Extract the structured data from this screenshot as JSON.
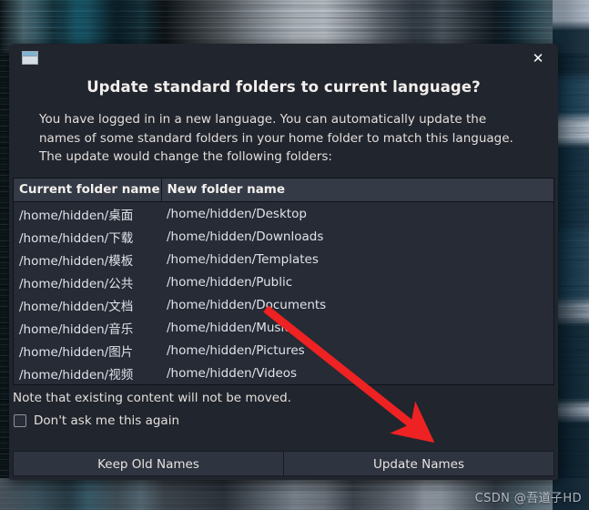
{
  "dialog": {
    "window_icon": "window-icon",
    "close_icon": "✕",
    "title": "Update standard folders to current language?",
    "body": "You have logged in in a new language. You can automatically update the names of some standard folders in your home folder to match this language. The update would change the following folders:",
    "note": "Note that existing content will not be moved.",
    "checkbox_label": "Don't ask me this again",
    "checkbox_checked": false,
    "buttons": {
      "keep": "Keep Old Names",
      "update": "Update Names"
    }
  },
  "table": {
    "headers": [
      "Current folder name",
      "New folder name"
    ],
    "rows": [
      [
        "/home/hidden/桌面",
        "/home/hidden/Desktop"
      ],
      [
        "/home/hidden/下载",
        "/home/hidden/Downloads"
      ],
      [
        "/home/hidden/模板",
        "/home/hidden/Templates"
      ],
      [
        "/home/hidden/公共",
        "/home/hidden/Public"
      ],
      [
        "/home/hidden/文档",
        "/home/hidden/Documents"
      ],
      [
        "/home/hidden/音乐",
        "/home/hidden/Music"
      ],
      [
        "/home/hidden/图片",
        "/home/hidden/Pictures"
      ],
      [
        "/home/hidden/视频",
        "/home/hidden/Videos"
      ]
    ]
  },
  "annotation": {
    "arrow_color": "#ee2222",
    "target": "update-names-button"
  },
  "watermark": "CSDN @吾道子HD",
  "colors": {
    "dialog_bg": "#21252e",
    "header_bg": "#343a46",
    "table_bg": "#262b35",
    "button_bg": "#2e3440",
    "text": "#e3dfdb"
  }
}
